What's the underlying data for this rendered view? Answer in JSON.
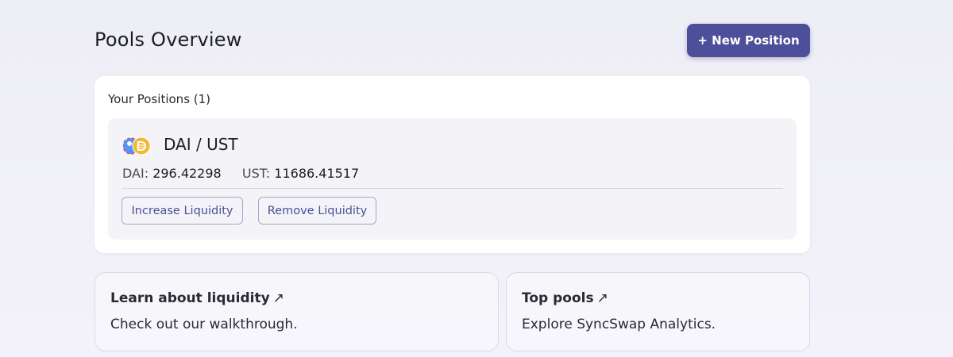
{
  "header": {
    "title": "Pools Overview",
    "new_position_label": "+ New Position"
  },
  "positions": {
    "heading": "Your Positions (1)",
    "items": [
      {
        "pair": "DAI / UST",
        "token_a": {
          "symbol": "DAI",
          "label": "DAI:",
          "amount": "296.42298"
        },
        "token_b": {
          "symbol": "UST",
          "label": "UST:",
          "amount": "11686.41517"
        },
        "icons": [
          "ust-token-icon",
          "dai-token-icon"
        ],
        "increase_label": "Increase Liquidity",
        "remove_label": "Remove Liquidity"
      }
    ]
  },
  "info_cards": [
    {
      "title": "Learn about liquidity",
      "arrow": "↗",
      "subtitle": "Check out our walkthrough."
    },
    {
      "title": "Top pools",
      "arrow": "↗",
      "subtitle": "Explore SyncSwap Analytics."
    }
  ],
  "colors": {
    "accent": "#4d4f9a",
    "dai_gold": "#f4b731",
    "ust_blue": "#5493f7"
  }
}
